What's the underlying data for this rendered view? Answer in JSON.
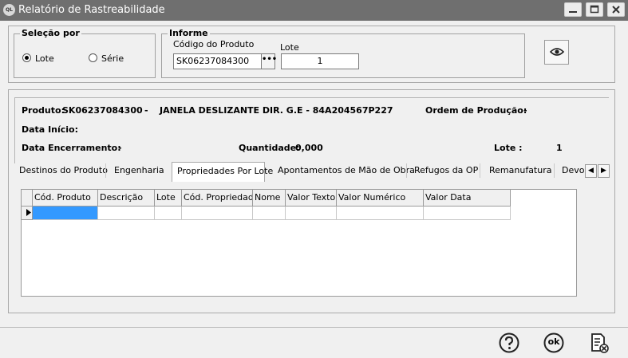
{
  "window": {
    "title": "Relatório de Rastreabilidade",
    "app_icon_text": "QL"
  },
  "selecao": {
    "title": "Seleção por",
    "options": [
      {
        "label": "Lote",
        "checked": true
      },
      {
        "label": "Série",
        "checked": false
      }
    ]
  },
  "informe": {
    "title": "Informe",
    "codigo_label": "Código do Produto",
    "codigo_value": "SK06237084300",
    "lookup_label": "•••",
    "lote_label": "Lote",
    "lote_value": "1"
  },
  "info": {
    "produto_label": "Produto:",
    "produto_code": "SK06237084300",
    "produto_sep": "-",
    "produto_desc": "JANELA DESLIZANTE DIR. G.E - 84A204567P227",
    "ordem_label": "Ordem de Produção:",
    "ordem_value": "-",
    "data_inicio_label": "Data Início:",
    "data_encerramento_label": "Data Encerramento:",
    "data_encerramento_value": "-",
    "quantidade_label": "Quantidade:",
    "quantidade_value": "0,000",
    "lote_label": "Lote :",
    "lote_value": "1"
  },
  "tabs": [
    {
      "label": "Destinos do Produto",
      "active": false
    },
    {
      "label": "Engenharia",
      "active": false
    },
    {
      "label": "Propriedades Por Lote",
      "active": true
    },
    {
      "label": "Apontamentos de Mão de Obra",
      "active": false
    },
    {
      "label": "Refugos da OP",
      "active": false
    },
    {
      "label": "Remanufatura",
      "active": false
    },
    {
      "label": "Devo",
      "active": false
    }
  ],
  "tab_scroll": {
    "left": "◀",
    "right": "▶"
  },
  "grid": {
    "columns": [
      "Cód. Produto",
      "Descrição",
      "Lote",
      "Cód. Propriedade",
      "Nome",
      "Valor Texto",
      "Valor Numérico",
      "Valor Data"
    ]
  },
  "footer": {
    "help_icon": "help-icon",
    "ok_icon": "ok-icon",
    "exit_icon": "close-report-icon",
    "ok_text": "ok"
  }
}
